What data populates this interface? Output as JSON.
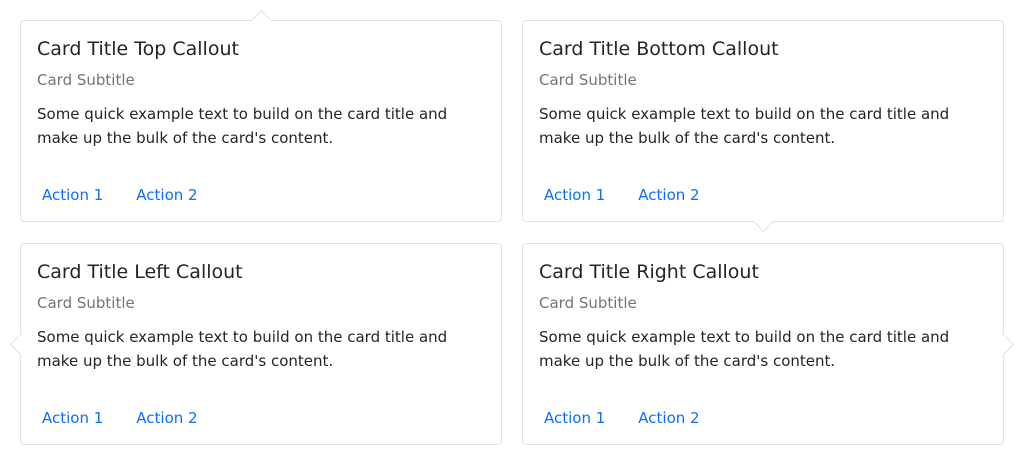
{
  "cards": [
    {
      "title": "Card Title Top Callout",
      "subtitle": "Card Subtitle",
      "text": "Some quick example text to build on the card title and make up the bulk of the card's content.",
      "actions": [
        "Action 1",
        "Action 2"
      ],
      "callout": "top"
    },
    {
      "title": "Card Title Bottom Callout",
      "subtitle": "Card Subtitle",
      "text": "Some quick example text to build on the card title and make up the bulk of the card's content.",
      "actions": [
        "Action 1",
        "Action 2"
      ],
      "callout": "bottom"
    },
    {
      "title": "Card Title Left Callout",
      "subtitle": "Card Subtitle",
      "text": "Some quick example text to build on the card title and make up the bulk of the card's content.",
      "actions": [
        "Action 1",
        "Action 2"
      ],
      "callout": "left"
    },
    {
      "title": "Card Title Right Callout",
      "subtitle": "Card Subtitle",
      "text": "Some quick example text to build on the card title and make up the bulk of the card's content.",
      "actions": [
        "Action 1",
        "Action 2"
      ],
      "callout": "right"
    }
  ],
  "colors": {
    "link": "#0d6efd",
    "subtitle": "#6c757d",
    "border": "#dee2e6",
    "text": "#212529"
  }
}
